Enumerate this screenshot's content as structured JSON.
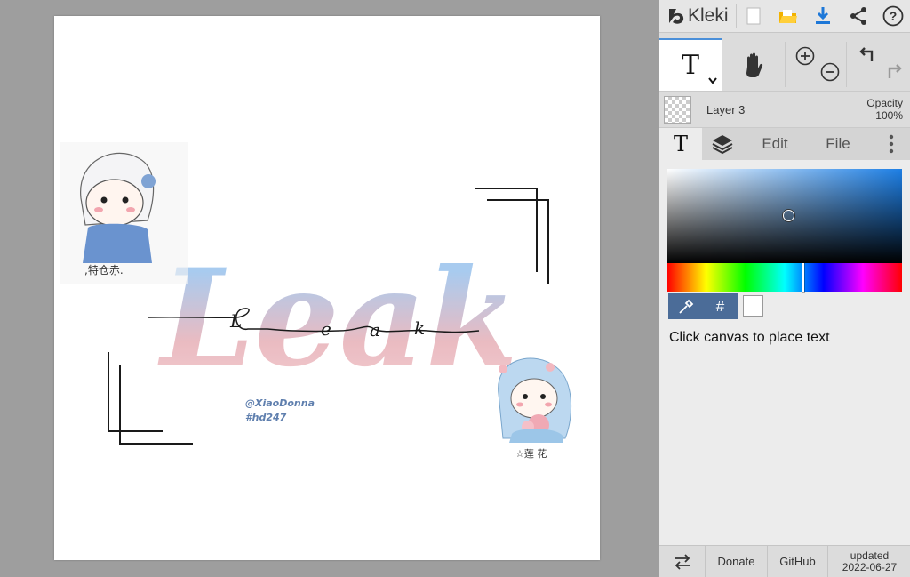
{
  "app": {
    "name": "Kleki"
  },
  "toolbar": {
    "icons": [
      "new-document-icon",
      "open-folder-icon",
      "download-icon",
      "share-icon",
      "help-icon"
    ]
  },
  "tools": {
    "text_tool_glyph": "T",
    "hand_tool": "hand-icon",
    "zoom": [
      "zoom-in-icon",
      "zoom-out-icon"
    ],
    "history": [
      "undo-icon",
      "redo-icon"
    ]
  },
  "layer": {
    "name": "Layer 3",
    "opacity_label": "Opacity",
    "opacity_value": "100%"
  },
  "tabs": {
    "text_tab": "T",
    "edit": "Edit",
    "file": "File"
  },
  "color": {
    "hue": "#1d7fe5",
    "selected_swatch": "#ffffff",
    "hash_button": "#",
    "accent": "#4a8fd9"
  },
  "hint": "Click canvas to place text",
  "footer": {
    "donate": "Donate",
    "github": "GitHub",
    "updated_label": "updated",
    "updated_date": "2022-06-27"
  },
  "canvas_art": {
    "credit_line1": "@XiaoDonna",
    "credit_line2": "#hd247",
    "big_word": "Leak",
    "script_letters": [
      "L",
      "e",
      "a",
      "k"
    ]
  }
}
